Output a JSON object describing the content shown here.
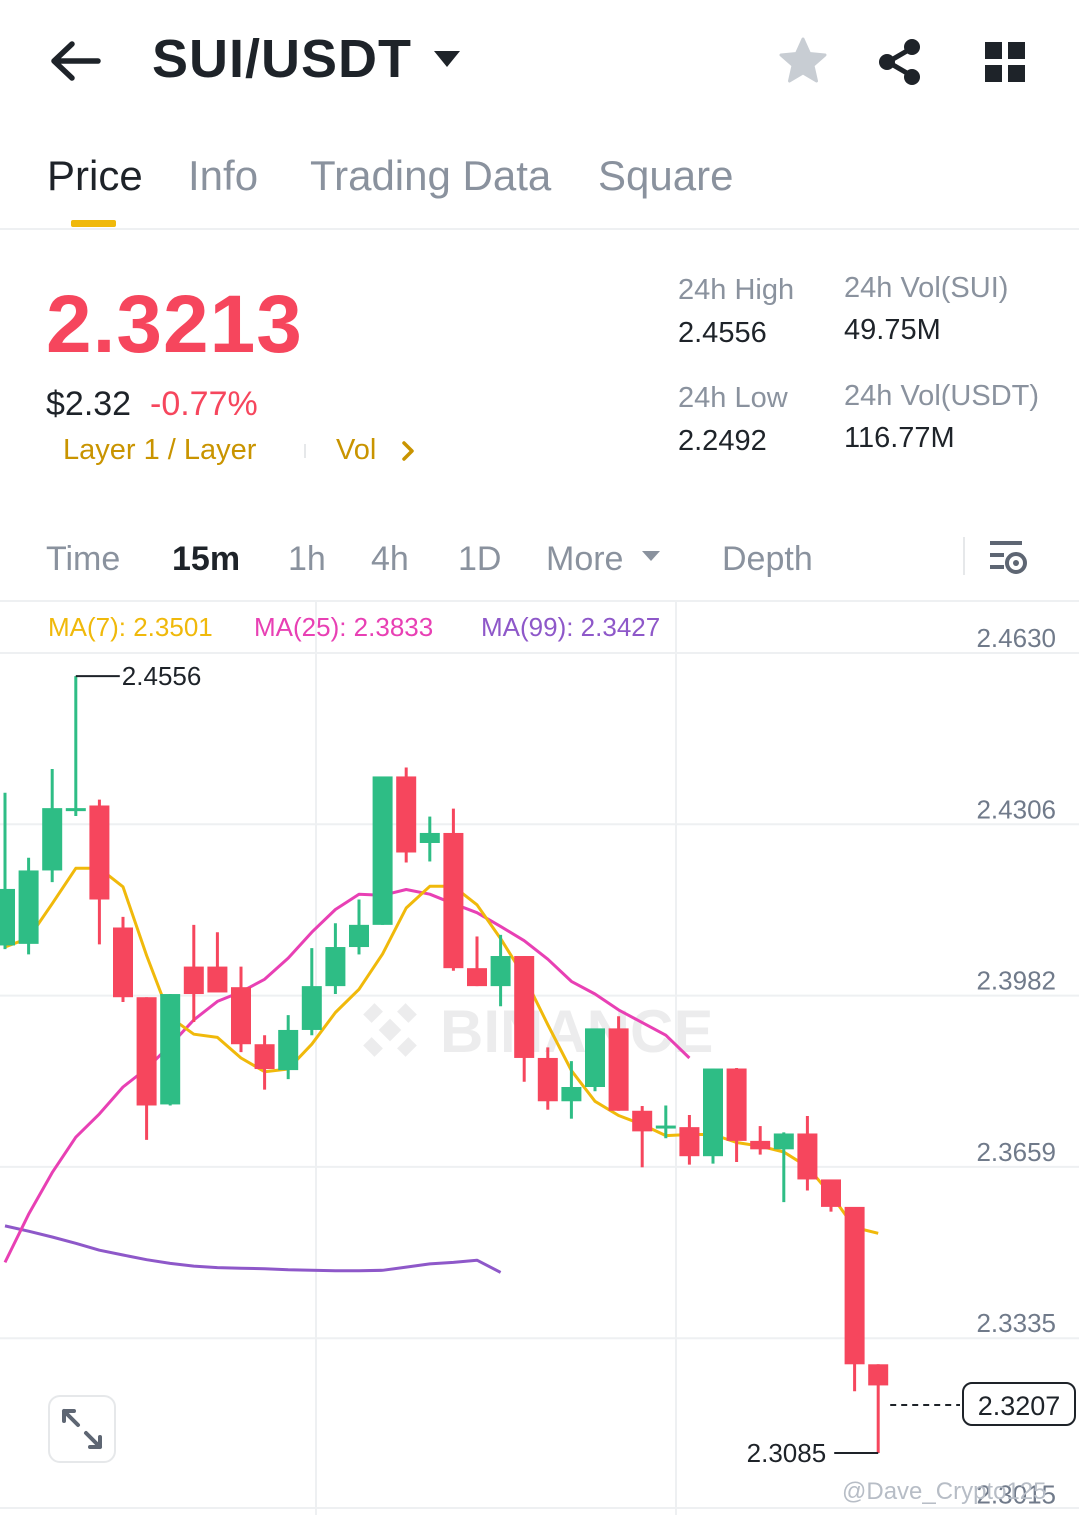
{
  "header": {
    "pair": "SUI/USDT",
    "icons": [
      "back-arrow-icon",
      "caret-down-icon",
      "star-icon",
      "share-icon",
      "grid-icon"
    ]
  },
  "tabs": [
    {
      "label": "Price",
      "active": true
    },
    {
      "label": "Info",
      "active": false
    },
    {
      "label": "Trading Data",
      "active": false
    },
    {
      "label": "Square",
      "active": false
    }
  ],
  "ticker": {
    "last_price": "2.3213",
    "usd_price": "$2.32",
    "change_pct": "-0.77%",
    "tag": "Layer 1 / Layer",
    "vol_link": "Vol",
    "stats": {
      "high_label": "24h High",
      "high_value": "2.4556",
      "low_label": "24h Low",
      "low_value": "2.2492",
      "vol_base_label": "24h Vol(SUI)",
      "vol_base_value": "49.75M",
      "vol_quote_label": "24h Vol(USDT)",
      "vol_quote_value": "116.77M"
    }
  },
  "intervals": {
    "items": [
      "Time",
      "15m",
      "1h",
      "4h",
      "1D",
      "More",
      "Depth"
    ],
    "active": "15m"
  },
  "indicators": {
    "ma7": "MA(7): 2.3501",
    "ma25": "MA(25): 2.3833",
    "ma99": "MA(99): 2.3427"
  },
  "colors": {
    "up": "#2ebd85",
    "down": "#f6465d",
    "accent": "#f0b90b",
    "ma7": "#f0b90b",
    "ma25": "#e840b4",
    "ma99": "#8e58c9"
  },
  "chart_data": {
    "type": "candlestick",
    "interval": "15m",
    "y_axis_labels": [
      "2.4630",
      "2.4306",
      "2.3982",
      "2.3659",
      "2.3335",
      "2.3015"
    ],
    "ylim": [
      2.3015,
      2.463
    ],
    "high_marker": "2.4556",
    "low_marker": "2.3085",
    "current_price_tag": "2.3207",
    "candles": [
      {
        "o": 2.4046,
        "h": 2.4335,
        "l": 2.4039,
        "c": 2.4153
      },
      {
        "o": 2.4049,
        "h": 2.4212,
        "l": 2.4029,
        "c": 2.4188
      },
      {
        "o": 2.4188,
        "h": 2.438,
        "l": 2.4166,
        "c": 2.4306
      },
      {
        "o": 2.4306,
        "h": 2.4556,
        "l": 2.4291,
        "c": 2.4306
      },
      {
        "o": 2.4311,
        "h": 2.4322,
        "l": 2.4048,
        "c": 2.4133
      },
      {
        "o": 2.408,
        "h": 2.41,
        "l": 2.3939,
        "c": 2.3948
      },
      {
        "o": 2.3948,
        "h": 2.3948,
        "l": 2.3678,
        "c": 2.3743
      },
      {
        "o": 2.3745,
        "h": 2.3954,
        "l": 2.3743,
        "c": 2.3954
      },
      {
        "o": 2.4006,
        "h": 2.4085,
        "l": 2.3901,
        "c": 2.3954
      },
      {
        "o": 2.4006,
        "h": 2.4071,
        "l": 2.3962,
        "c": 2.3957
      },
      {
        "o": 2.3967,
        "h": 2.4006,
        "l": 2.3844,
        "c": 2.3859
      },
      {
        "o": 2.3859,
        "h": 2.3876,
        "l": 2.3773,
        "c": 2.3812
      },
      {
        "o": 2.381,
        "h": 2.3914,
        "l": 2.3793,
        "c": 2.3886
      },
      {
        "o": 2.3886,
        "h": 2.4041,
        "l": 2.3876,
        "c": 2.3969
      },
      {
        "o": 2.3969,
        "h": 2.4088,
        "l": 2.3954,
        "c": 2.4043
      },
      {
        "o": 2.4043,
        "h": 2.4133,
        "l": 2.4029,
        "c": 2.4085
      },
      {
        "o": 2.4085,
        "h": 2.4366,
        "l": 2.4085,
        "c": 2.4366
      },
      {
        "o": 2.4366,
        "h": 2.4383,
        "l": 2.4203,
        "c": 2.4222
      },
      {
        "o": 2.424,
        "h": 2.429,
        "l": 2.4205,
        "c": 2.4259
      },
      {
        "o": 2.4259,
        "h": 2.4305,
        "l": 2.3998,
        "c": 2.4003
      },
      {
        "o": 2.4003,
        "h": 2.4063,
        "l": 2.3969,
        "c": 2.3969
      },
      {
        "o": 2.3969,
        "h": 2.4066,
        "l": 2.3931,
        "c": 2.4026
      },
      {
        "o": 2.4026,
        "h": 2.4026,
        "l": 2.3788,
        "c": 2.3833
      },
      {
        "o": 2.3833,
        "h": 2.3853,
        "l": 2.3735,
        "c": 2.3751
      },
      {
        "o": 2.3751,
        "h": 2.3827,
        "l": 2.3718,
        "c": 2.3778
      },
      {
        "o": 2.3778,
        "h": 2.3886,
        "l": 2.377,
        "c": 2.3889
      },
      {
        "o": 2.3889,
        "h": 2.3912,
        "l": 2.3733,
        "c": 2.3733
      },
      {
        "o": 2.3733,
        "h": 2.3742,
        "l": 2.3626,
        "c": 2.3694
      },
      {
        "o": 2.3702,
        "h": 2.3743,
        "l": 2.3681,
        "c": 2.3705
      },
      {
        "o": 2.3702,
        "h": 2.3725,
        "l": 2.3631,
        "c": 2.3647
      },
      {
        "o": 2.3647,
        "h": 2.3813,
        "l": 2.3633,
        "c": 2.3813
      },
      {
        "o": 2.3813,
        "h": 2.3814,
        "l": 2.3636,
        "c": 2.3676
      },
      {
        "o": 2.3676,
        "h": 2.3704,
        "l": 2.365,
        "c": 2.366
      },
      {
        "o": 2.366,
        "h": 2.3692,
        "l": 2.356,
        "c": 2.369
      },
      {
        "o": 2.369,
        "h": 2.3723,
        "l": 2.3582,
        "c": 2.3603
      },
      {
        "o": 2.3603,
        "h": 2.3568,
        "l": 2.3542,
        "c": 2.3551
      },
      {
        "o": 2.3551,
        "h": 2.3526,
        "l": 2.3202,
        "c": 2.3253
      },
      {
        "o": 2.3253,
        "h": 2.3253,
        "l": 2.3085,
        "c": 2.3213
      }
    ],
    "ma7_series": [
      2.4043,
      2.406,
      2.4125,
      2.4192,
      2.4192,
      2.4157,
      2.4027,
      2.391,
      2.3878,
      2.3872,
      2.3833,
      2.3807,
      2.3812,
      2.3859,
      2.3919,
      2.3963,
      2.403,
      2.4117,
      2.4158,
      2.4158,
      2.4123,
      2.4059,
      2.3987,
      2.3896,
      2.3809,
      2.3751,
      2.3724,
      2.3707,
      2.3686,
      2.3688,
      2.3688,
      2.3673,
      2.3666,
      2.3655,
      2.3627,
      2.3574,
      2.3512,
      2.3501
    ],
    "ma25_series": [
      2.3446,
      2.3537,
      2.3616,
      2.3683,
      2.3727,
      2.3778,
      2.3813,
      2.3857,
      2.3905,
      2.394,
      2.3958,
      2.3982,
      2.4022,
      2.4071,
      2.4114,
      2.4143,
      2.4141,
      2.4152,
      2.4143,
      2.4125,
      2.4108,
      2.4082,
      2.4055,
      2.402,
      2.3978,
      2.3954,
      2.3924,
      2.39,
      2.3876,
      2.3833
    ],
    "ma99_series": [
      2.3515,
      2.3505,
      2.3494,
      2.3482,
      2.3469,
      2.346,
      2.3451,
      2.3444,
      2.3439,
      2.3436,
      2.3435,
      2.3434,
      2.3432,
      2.3431,
      2.343,
      2.343,
      2.3431,
      2.3437,
      2.3443,
      2.3446,
      2.345,
      2.3427
    ]
  },
  "expand_icon": "expand-icon",
  "watermark": "@Dave_Crypto125"
}
